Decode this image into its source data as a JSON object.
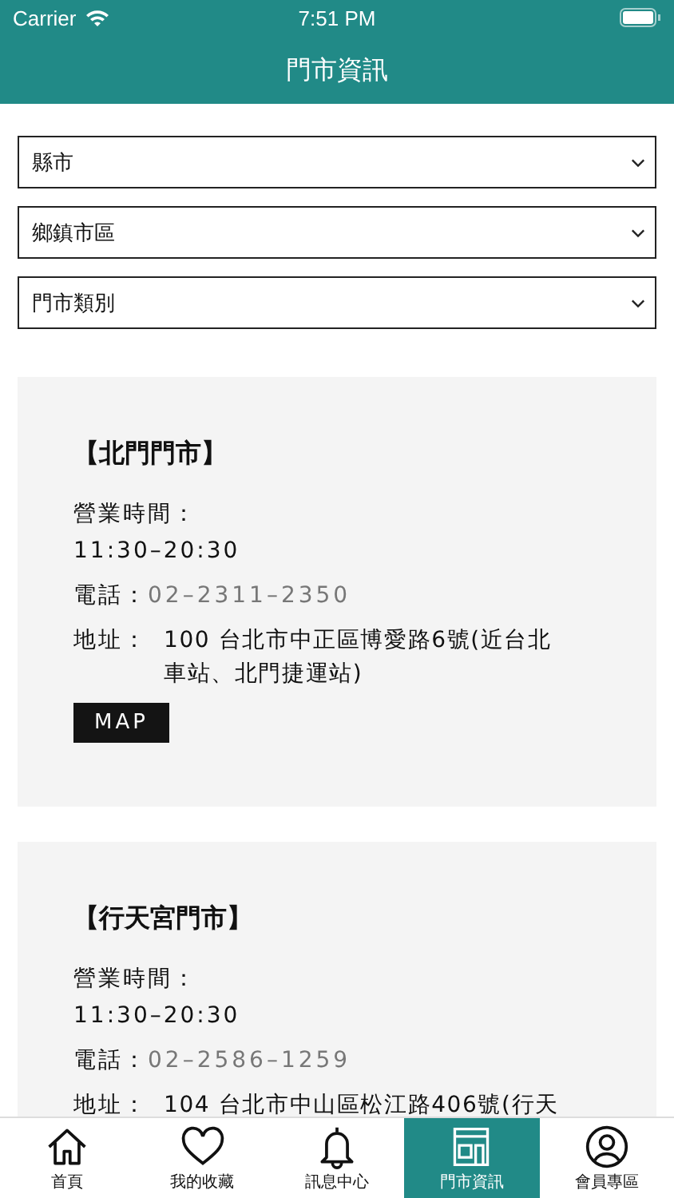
{
  "status_bar": {
    "carrier": "Carrier",
    "time": "7:51 PM"
  },
  "header": {
    "title": "門市資訊"
  },
  "filters": [
    {
      "label": "縣市"
    },
    {
      "label": "鄉鎮市區"
    },
    {
      "label": "門市類別"
    }
  ],
  "stores": [
    {
      "name": "【北門門市】",
      "hours_label": "營業時間：",
      "hours": "11:30–20:30",
      "phone_label": "電話：",
      "phone": "02–2311–2350",
      "address_label": "地址：",
      "address": "100 台北市中正區博愛路6號(近台北車站、北門捷運站)",
      "map_button": "MAP"
    },
    {
      "name": "【行天宮門市】",
      "hours_label": "營業時間：",
      "hours": "11:30–20:30",
      "phone_label": "電話：",
      "phone": "02–2586–1259",
      "address_label": "地址：",
      "address": "104 台北市中山區松江路406號(行天"
    }
  ],
  "tab_bar": [
    {
      "kind": "home",
      "label": "首頁",
      "selected": false
    },
    {
      "kind": "heart",
      "label": "我的收藏",
      "selected": false
    },
    {
      "kind": "bell",
      "label": "訊息中心",
      "selected": false
    },
    {
      "kind": "store",
      "label": "門市資訊",
      "selected": true
    },
    {
      "kind": "person",
      "label": "會員專區",
      "selected": false
    }
  ]
}
